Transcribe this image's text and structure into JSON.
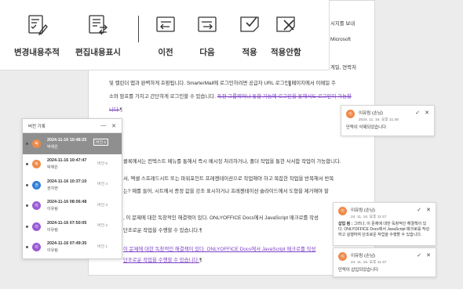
{
  "toolbar": {
    "buttons": [
      {
        "label": "변경내용추적",
        "icon": "track-changes-icon"
      },
      {
        "label": "편집내용표시",
        "icon": "display-mode-icon"
      },
      {
        "label": "이전",
        "icon": "previous-change-icon"
      },
      {
        "label": "다음",
        "icon": "next-change-icon"
      },
      {
        "label": "적용",
        "icon": "accept-change-icon"
      },
      {
        "label": "적용안함",
        "icon": "reject-change-icon"
      }
    ]
  },
  "document": {
    "line1_right": "시지를 보내",
    "line2_right": "Microsoft",
    "line3_right": "게일, 연락처",
    "line4": "및 캘린더 앱과 완벽하게 호환됩니다. SmarterMail에 로그인하려면 공급자 URL 로그인",
    "line4b": "페이지에서 이메일 주",
    "line5": "소와 암호를 가지고 간단하게 로그인할 수 있습니다.",
    "line5_deleted": "특정 그룹웨어나 통합 기능에 로그인을 통해서도 로그인이 가능할",
    "line6_deleted": "니다.",
    "pilcrow": "¶",
    "line7": "콜록에서는 컨텍스트 메뉴를 통해서 즉시 메시징 처리하거나, 폴더 작업을 통한 사서함 작업이 가능합니다.",
    "line8": "서, 엑셀 스프레드시트 또는 파워포인트 프레젠테이션으로 작업해야 하고 복잡한 작업을 반복해서 반복",
    "line9": "는? 예를 들어, 시트에서 증정 값을 강조 표시하거나 프레젠테이션 슬라이드에서 도형을 제거해야 할",
    "line10": ", 이 문제에 대한 독창적인 해결책이 있다. ONLYOFFICE Docs에서 JavaScript 매크로를 작성",
    "line11": "단조로운 작업을 수행할 수 있습니다.",
    "line12": "이 문제에 대한 독창적인 해결책이 있다. ONLYOFFICE Docs에서 JavaScript 매크로를 작성",
    "line13": "단조로운 작업을 수행할 수 있습니다."
  },
  "version_history": {
    "title": "버전 기록",
    "minimize": "—",
    "close": "✕",
    "items": [
      {
        "date": "2024-11-16 10:48:25",
        "user": "박재은",
        "version": "버전 6",
        "initial": "박",
        "color": "#ef8a4a",
        "selected": true
      },
      {
        "date": "2024-11-16 10:47:47",
        "user": "박재은",
        "version": "버전 5",
        "initial": "박",
        "color": "#ef8a4a",
        "selected": false
      },
      {
        "date": "2024-11-16 10:37:10",
        "user": "권지현",
        "version": "버전 4",
        "initial": "권",
        "color": "#2f7fd8",
        "selected": false
      },
      {
        "date": "2024-11-16 08:06:48",
        "user": "이유림",
        "version": "버전 3",
        "initial": "이",
        "color": "#9a5ad6",
        "selected": false
      },
      {
        "date": "2024-11-16 07:50:05",
        "user": "이유림",
        "version": "버전 2",
        "initial": "이",
        "color": "#9a5ad6",
        "selected": false
      },
      {
        "date": "2024-11-16 07:49:35",
        "user": "이유림",
        "version": "버전 1",
        "initial": "이",
        "color": "#9a5ad6",
        "selected": false
      }
    ]
  },
  "comments": [
    {
      "name": "이유림 (손님)",
      "date": "2024. 11. 16. 오후 11:48",
      "label": "",
      "body": "단락이 삭제되었습니다",
      "initial": "이"
    },
    {
      "name": "이유림 (손님)",
      "date": "24. 11. 16. 오후 11:47",
      "label": "삽입 됨 :",
      "body": "그러나, 이 문제에 대한 독창적인 해결책이 있다. ONLYOFFICE Docs에서 JavaScript 매크로를 작성하고 실행하여 단조로운 작업을 수행할 수 있습니다.",
      "initial": "이"
    },
    {
      "name": "이유림 (손님)",
      "date": "24. 11. 16. 오후 11:47",
      "label": "",
      "body": "단락이 삽입되었습니다",
      "initial": "이"
    }
  ],
  "comment_actions": {
    "accept": "✓",
    "reject": "✕"
  }
}
